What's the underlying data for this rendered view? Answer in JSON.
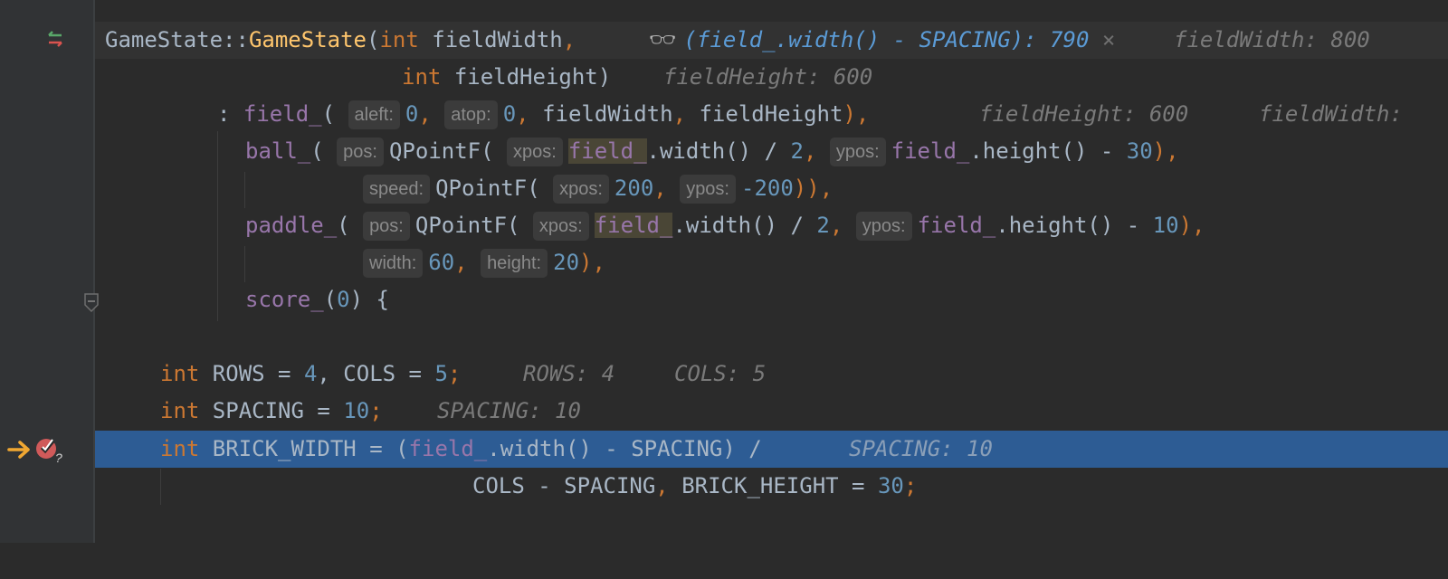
{
  "lines": {
    "l1": {
      "class_name": "GameState",
      "sep": "::",
      "ctor": "GameState",
      "paren": "(",
      "kw": "int",
      "param": "fieldWidth",
      "comma": ","
    },
    "l2": {
      "kw": "int",
      "param": "fieldHeight",
      "close": ")"
    },
    "l3": {
      "colon": ":",
      "member": "field_",
      "open": "(",
      "hint_aleft": "aleft:",
      "v0a": "0",
      "c1": ",",
      "hint_atop": "atop:",
      "v0b": "0",
      "c2": ",",
      "a3": "fieldWidth",
      "c3": ",",
      "a4": "fieldHeight",
      "close": "),"
    },
    "l4": {
      "member": "ball_",
      "open": "(",
      "hint_pos": "pos:",
      "qp": "QPointF(",
      "hint_xpos": "xpos:",
      "f1": "field_",
      "w": ".width() / ",
      "two": "2",
      "c1": ",",
      "hint_ypos": "ypos:",
      "f2": "field_",
      "h": ".height() - ",
      "n": "30",
      "close": "),"
    },
    "l5": {
      "hint_speed": "speed:",
      "qp": "QPointF(",
      "hint_xpos": "xpos:",
      "v1": "200",
      "c1": ",",
      "hint_ypos": "ypos:",
      "v2": "-200",
      "close": ")),"
    },
    "l6": {
      "member": "paddle_",
      "open": "(",
      "hint_pos": "pos:",
      "qp": "QPointF(",
      "hint_xpos": "xpos:",
      "f1": "field_",
      "w": ".width() / ",
      "two": "2",
      "c1": ",",
      "hint_ypos": "ypos:",
      "f2": "field_",
      "h": ".height() - ",
      "n": "10",
      "close": "),"
    },
    "l7": {
      "hint_width": "width:",
      "v1": "60",
      "c1": ",",
      "hint_height": "height:",
      "v2": "20",
      "close": "),"
    },
    "l8": {
      "member": "score_",
      "open": "(",
      "v": "0",
      "close": ") {"
    },
    "l10": {
      "kw1": "int",
      "rows": " ROWS = ",
      "v1": "4",
      "c": ", COLS = ",
      "v2": "5",
      "semi": ";"
    },
    "l11": {
      "kw": "int",
      "sp": " SPACING = ",
      "v": "10",
      "semi": ";"
    },
    "l12": {
      "kw": "int",
      "bw": " BRICK_WIDTH = (",
      "f": "field_",
      "rest": ".width() - SPACING) /"
    },
    "l13": {
      "a": "COLS - SPACING",
      "c": ",",
      "b": " BRICK_HEIGHT = ",
      "v": "30",
      "semi": ";"
    }
  },
  "inline_values": {
    "watch_expr": "(field_.width() - SPACING): 790",
    "watch_close": "×",
    "fieldWidth_1": "fieldWidth: 800",
    "fieldHeight_2": "fieldHeight: 600",
    "fieldHeight_3": "fieldHeight: 600",
    "fieldWidth_3": "fieldWidth:",
    "rows": "ROWS: 4",
    "cols": "COLS: 5",
    "spacing_11": "SPACING: 10",
    "spacing_12": "SPACING: 10"
  },
  "gutter": {
    "swap_icon": "swap-arrows-icon",
    "breakpoint_icon": "breakpoint-icon",
    "exec_arrow_icon": "execution-point-arrow-icon",
    "fold_icon": "fold-icon",
    "breakpoint_badge": "?"
  },
  "colors": {
    "background": "#2b2b2b",
    "exec_line": "#2d5c94",
    "keyword": "#cc7832",
    "function": "#ffc66d",
    "number": "#6897bb",
    "member": "#9876aa",
    "inline_value": "#7a7a7a",
    "watch": "#5b9bd6"
  }
}
